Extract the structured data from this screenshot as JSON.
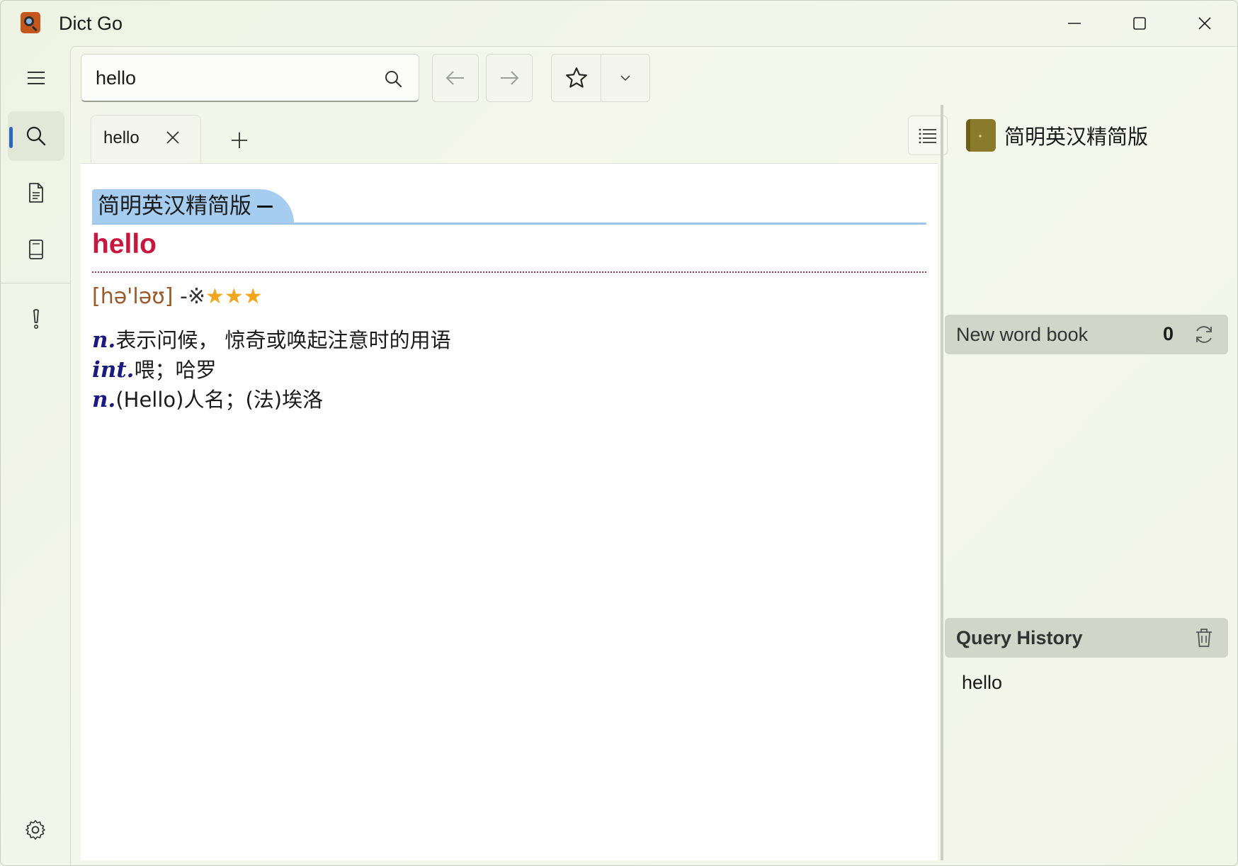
{
  "window": {
    "title": "Dict Go"
  },
  "search": {
    "value": "hello",
    "placeholder": ""
  },
  "tabs": [
    {
      "label": "hello"
    }
  ],
  "entry": {
    "dictionary": "简明英汉精简版",
    "headword": "hello",
    "phonetic": "[hə'ləʊ]",
    "mark": " -※",
    "stars": "★★★",
    "senses": [
      {
        "pos": "n.",
        "text": "表示问候， 惊奇或唤起注意时的用语"
      },
      {
        "pos": "int.",
        "text": "喂；哈罗"
      },
      {
        "pos": "n.",
        "text": "(Hello)人名；(法)埃洛"
      }
    ]
  },
  "right_panel": {
    "dictionaries": [
      {
        "label": "简明英汉精简版"
      }
    ],
    "new_word_book": {
      "label": "New word book",
      "count": "0"
    },
    "query_history": {
      "label": "Query History",
      "items": [
        "hello"
      ]
    }
  },
  "icons": {
    "nav": [
      "menu-icon",
      "search-icon",
      "document-icon",
      "book-icon",
      "tip-icon",
      "settings-icon"
    ],
    "toolbar": [
      "back-arrow-icon",
      "forward-arrow-icon",
      "star-icon",
      "chevron-down-icon"
    ]
  },
  "colors": {
    "headword": "#c8173f",
    "dict_header": "#a6cdf0",
    "phonetic": "#9b5a2b",
    "stars": "#f3a51c",
    "pos": "#1a1a80",
    "accent": "#2b67c0"
  }
}
